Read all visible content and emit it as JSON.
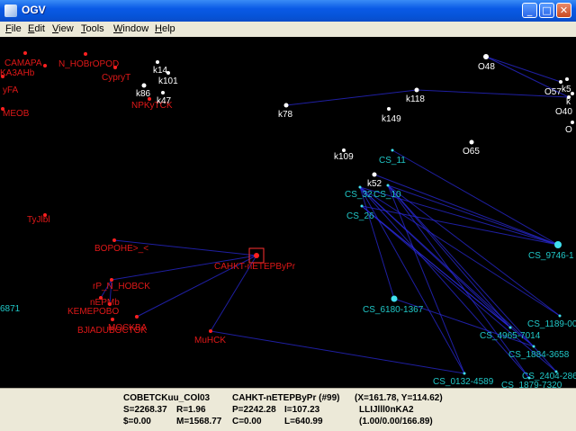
{
  "window": {
    "title": "OGV",
    "controls": {
      "minimize": "_",
      "maximize": "□",
      "close": "✕"
    }
  },
  "menu": [
    {
      "label": "File",
      "mnemonic": "F"
    },
    {
      "label": "Edit",
      "mnemonic": "E"
    },
    {
      "label": "View",
      "mnemonic": "V"
    },
    {
      "label": "Tools",
      "mnemonic": "T"
    },
    {
      "label": "Window",
      "mnemonic": "W"
    },
    {
      "label": "Help",
      "mnemonic": "H"
    }
  ],
  "colors": {
    "background": "#000000",
    "red_label": "#e01818",
    "red_node": "#ff2020",
    "white_node": "#ffffff",
    "cyan_label": "#20c8c8",
    "cyan_node": "#40e0f0",
    "edge": "#2a2ad8",
    "selection": "#ff3030"
  },
  "graph": {
    "nodes": [
      {
        "id": "SAMARA",
        "label": "CAMAPA",
        "group": "red"
      },
      {
        "id": "NNOV",
        "label": "N_HOBrOPOD",
        "group": "red"
      },
      {
        "id": "KAZ",
        "label": "KA3AHb",
        "group": "red"
      },
      {
        "id": "SURGUT",
        "label": "CypryT",
        "group": "red"
      },
      {
        "id": "UFA",
        "label": "yFA",
        "group": "red"
      },
      {
        "id": "IRKUTSK",
        "label": "NPKyTCK",
        "group": "red"
      },
      {
        "id": "MEOB",
        "label": "MEOB",
        "group": "red"
      },
      {
        "id": "TULA",
        "label": "TyJlbl",
        "group": "red"
      },
      {
        "id": "VORONEZH",
        "label": "BOPOHE>_<",
        "group": "red"
      },
      {
        "id": "SPB",
        "label": "CAHKT-nETEPByPr",
        "group": "red"
      },
      {
        "id": "GRNOV",
        "label": "rP_N_HOBCK",
        "group": "red"
      },
      {
        "id": "PERM",
        "label": "nEPMb",
        "group": "red"
      },
      {
        "id": "KEMEROVO",
        "label": "KEMEPOBO",
        "group": "red"
      },
      {
        "id": "VLADIVOSTOK",
        "label": "BJlADUBOCTOK",
        "group": "red"
      },
      {
        "id": "MOSKVA",
        "label": "MOCKBA",
        "group": "red"
      },
      {
        "id": "MINSK",
        "label": "MuHCK",
        "group": "red"
      },
      {
        "id": "k14",
        "label": "k14",
        "group": "white"
      },
      {
        "id": "k101",
        "label": "k101",
        "group": "white"
      },
      {
        "id": "k86",
        "label": "k86",
        "group": "white"
      },
      {
        "id": "k47",
        "label": "k47",
        "group": "white"
      },
      {
        "id": "k78",
        "label": "k78",
        "group": "white"
      },
      {
        "id": "k118",
        "label": "k118",
        "group": "white"
      },
      {
        "id": "k149",
        "label": "k149",
        "group": "white"
      },
      {
        "id": "k109",
        "label": "k109",
        "group": "white"
      },
      {
        "id": "k52",
        "label": "k52",
        "group": "white"
      },
      {
        "id": "O48",
        "label": "O48",
        "group": "white"
      },
      {
        "id": "O57",
        "label": "O57",
        "group": "white"
      },
      {
        "id": "O40",
        "label": "O40",
        "group": "white"
      },
      {
        "id": "O65",
        "label": "O65",
        "group": "white"
      },
      {
        "id": "O_edge",
        "label": "O",
        "group": "white"
      },
      {
        "id": "k5",
        "label": "k5",
        "group": "white"
      },
      {
        "id": "k_edge",
        "label": "k",
        "group": "white"
      },
      {
        "id": "CS_11",
        "label": "CS_11",
        "group": "cyan"
      },
      {
        "id": "CS_32",
        "label": "CS_32",
        "group": "cyan"
      },
      {
        "id": "CS_10",
        "label": "CS_10",
        "group": "cyan"
      },
      {
        "id": "CS_26",
        "label": "CS_26",
        "group": "cyan"
      },
      {
        "id": "CS_9746",
        "label": "CS_9746-1",
        "group": "cyan"
      },
      {
        "id": "CS_6180",
        "label": "CS_6180-1367",
        "group": "cyan"
      },
      {
        "id": "CS_1189",
        "label": "CS_1189-00",
        "group": "cyan"
      },
      {
        "id": "CS_4965",
        "label": "CS_4965-7014",
        "group": "cyan"
      },
      {
        "id": "CS_1884",
        "label": "CS_1884-3658",
        "group": "cyan"
      },
      {
        "id": "CS_2404",
        "label": "CS_2404-286",
        "group": "cyan"
      },
      {
        "id": "CS_0132",
        "label": "CS_0132-4589",
        "group": "cyan"
      },
      {
        "id": "CS_1879",
        "label": "CS_1879-7320",
        "group": "cyan"
      },
      {
        "id": "n6871",
        "label": "6871",
        "group": "cyan"
      }
    ],
    "selected_node": "SPB"
  },
  "status": {
    "row1": {
      "name": "COBETCKuu_COl03",
      "selected": "CAHKT-nETEPByPr  (#99)",
      "coords": "(X=161.78, Y=114.62)"
    },
    "row2": {
      "s": "S=2268.37",
      "r": "R=1.96",
      "p": "P=2242.28",
      "i": "I=107.23",
      "code": "LLIJlll0nKA2"
    },
    "row3": {
      "dollar": "$=0.00",
      "m": "M=1568.77",
      "c": "C=0.00",
      "l": "L=640.99",
      "ratio": "(1.00/0.00/166.89)"
    }
  }
}
